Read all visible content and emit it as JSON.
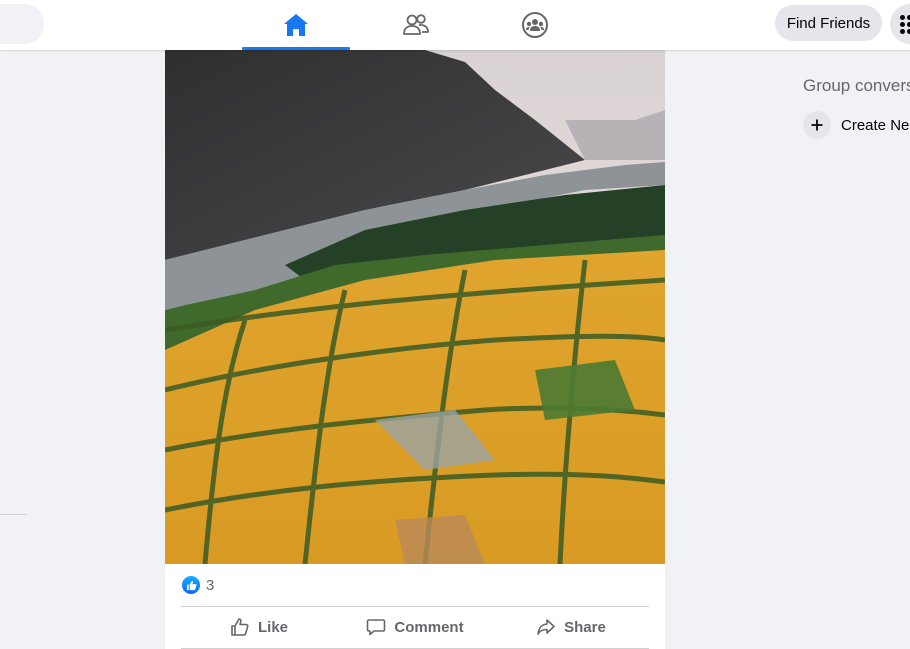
{
  "colors": {
    "accent": "#1877f2",
    "background": "#f0f2f5",
    "secondary_text": "#65676b"
  },
  "header": {
    "tabs": [
      {
        "icon": "home-icon",
        "active": true
      },
      {
        "icon": "friends-icon",
        "active": false
      },
      {
        "icon": "groups-icon",
        "active": false
      }
    ],
    "find_friends_label": "Find Friends",
    "menu_icon": "grid-menu-icon"
  },
  "post": {
    "image_description": "aerial photo",
    "reaction_count": "3",
    "actions": {
      "like": "Like",
      "comment": "Comment",
      "share": "Share"
    }
  },
  "right_panel": {
    "group_heading": "Group convers",
    "create_new_label": "Create Ne"
  }
}
